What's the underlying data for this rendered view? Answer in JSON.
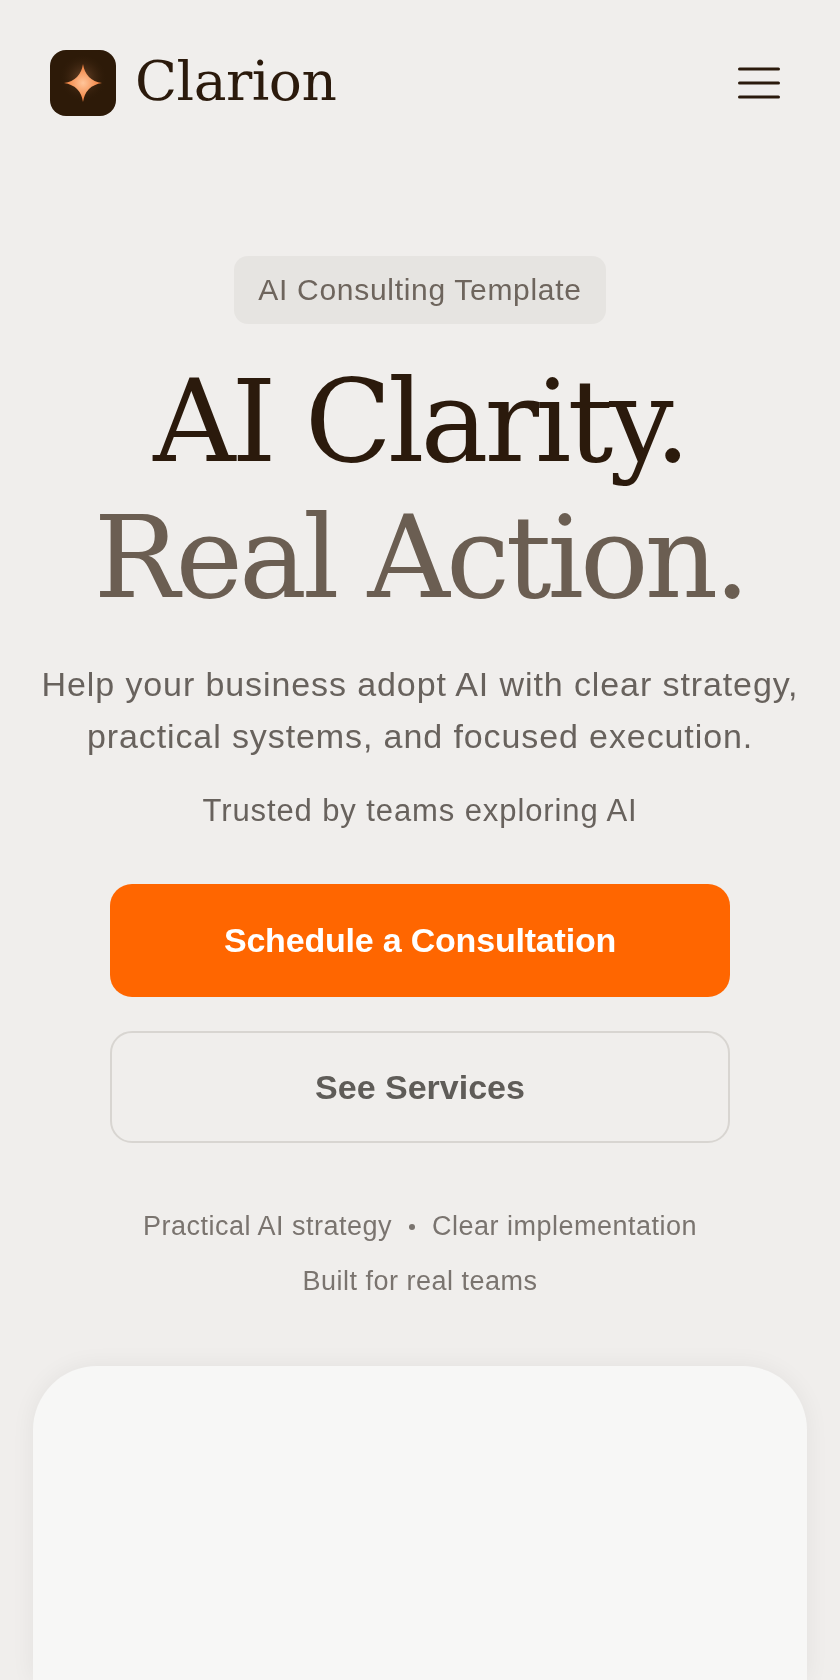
{
  "header": {
    "brand": "Clarion"
  },
  "hero": {
    "badge": "AI Consulting Template",
    "headline": [
      {
        "text": "AI Clarity.",
        "kind": "dark"
      },
      {
        "text": "Real Action.",
        "kind": "muted"
      }
    ],
    "description": "Help your business adopt AI with clear strategy, practical systems, and focused execution.",
    "trust_line": "Trusted by teams exploring AI",
    "buttons": [
      {
        "label": "Schedule a Consultation",
        "kind": "primary"
      },
      {
        "label": "See Services",
        "kind": "secondary"
      }
    ],
    "highlights": [
      [
        "Practical AI strategy",
        "Clear implementation"
      ],
      [
        "Built for real teams"
      ]
    ]
  }
}
